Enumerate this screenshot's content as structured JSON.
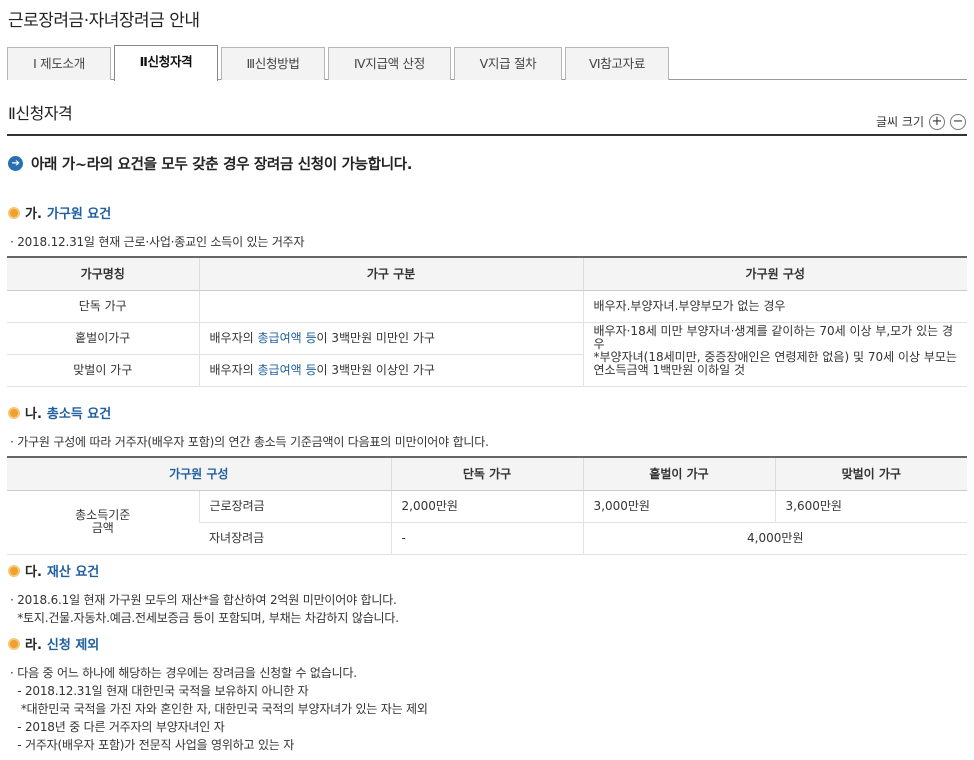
{
  "page_title": "근로장려금·자녀장려금 안내",
  "tabs": [
    {
      "label": "Ⅰ 제도소개"
    },
    {
      "label": "Ⅱ신청자격"
    },
    {
      "label": "Ⅲ신청방법"
    },
    {
      "label": "Ⅳ지급액 산정"
    },
    {
      "label": "Ⅴ지급 절차"
    },
    {
      "label": "Ⅵ참고자료"
    }
  ],
  "section_title": "Ⅱ신청자격",
  "font_size_control": {
    "label": "글씨 크기",
    "plus": "+",
    "minus": "−"
  },
  "headline": "아래 가~라의 요건을 모두 갖춘 경우 장려금 신청이 가능합니다.",
  "sec_a": {
    "prefix": "가.",
    "name": "가구원 요건",
    "desc": "· 2018.12.31일 현재 근로·사업·종교인 소득이 있는 거주자",
    "headers": [
      "가구명칭",
      "가구 구분",
      "가구원 구성"
    ],
    "rows": [
      {
        "name": "단독 가구",
        "type": "",
        "comp": "배우자.부양자녀.부양부모가 없는 경우"
      },
      {
        "name": "홑벌이가구",
        "pre": "배우자의 ",
        "link": "총급여액 등",
        "post": "이 3백만원 미만인 가구"
      },
      {
        "name": "맞벌이 가구",
        "pre": "배우자의 ",
        "link": "총급여액 등",
        "post": "이 3백만원 이상인 가구"
      }
    ],
    "comp_merged_1": "배우자·18세 미만 부양자녀·생계를 같이하는 70세 이상 부,모가 있는 경우",
    "comp_merged_2": "*부양자녀(18세미만, 중증장애인은 연령제한 없음) 및 70세 이상 부모는 연소득금액 1백만원 이하일 것"
  },
  "sec_b": {
    "prefix": "나.",
    "name": "총소득 요건",
    "desc": "· 가구원 구성에 따라 거주자(배우자 포함)의 연간 총소득 기준금액이 다음표의 미만이어야 합니다.",
    "headers": [
      "가구원 구성",
      "단독 가구",
      "홑벌이 가구",
      "맞벌이 가구"
    ],
    "row_label": "총소득기준\n금액",
    "rows": [
      {
        "label": "근로장려금",
        "single": "2,000만원",
        "one": "3,000만원",
        "two": "3,600만원"
      },
      {
        "label": "자녀장려금",
        "single": "-",
        "merged": "4,000만원"
      }
    ]
  },
  "sec_c": {
    "prefix": "다.",
    "name": "재산 요건",
    "lines": [
      "· 2018.6.1일 현재 가구원 모두의 재산*을 합산하여 2억원 미만이어야 합니다.",
      "  *토지.건물.자동차.예금.전세보증금 등이 포함되며, 부채는 차감하지 않습니다."
    ]
  },
  "sec_d": {
    "prefix": "라.",
    "name": "신청 제외",
    "lines": [
      "· 다음 중 어느 하나에 해당하는 경우에는 장려금을 신청할 수 없습니다.",
      "  - 2018.12.31일 현재 대한민국 국적을 보유하지 아니한 자",
      "   *대한민국 국적을 가진 자와 혼인한 자, 대한민국 국적의 부양자녀가 있는 자는 제외",
      "  - 2018년 중 다른 거주자의 부양자녀인 자",
      "  - 거주자(배우자 포함)가 전문직 사업을 영위하고 있는 자"
    ]
  }
}
